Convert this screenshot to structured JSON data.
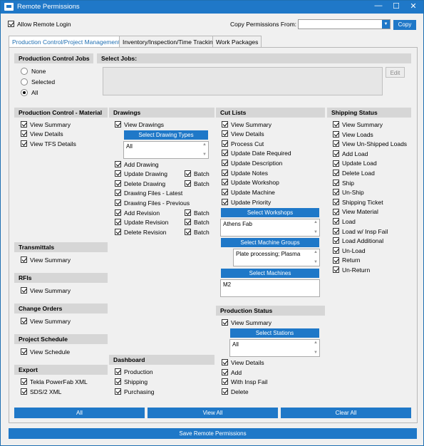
{
  "window": {
    "title": "Remote Permissions",
    "minimize": "—",
    "maximize": "☐",
    "close": "✕"
  },
  "top": {
    "allow_remote_login": "Allow Remote Login",
    "copy_from_label": "Copy Permissions From:",
    "copy_from_value": "",
    "copy_button": "Copy"
  },
  "tabs": [
    "Production Control/Project Management",
    "Inventory/Inspection/Time Tracking",
    "Work Packages"
  ],
  "pc_jobs": {
    "title": "Production Control Jobs",
    "options": [
      "None",
      "Selected",
      "All"
    ],
    "selected": "All"
  },
  "select_jobs": {
    "title": "Select Jobs:",
    "edit_button": "Edit"
  },
  "pcm": {
    "title": "Production Control - Material",
    "items": [
      "View Summary",
      "View Details",
      "View TFS Details"
    ]
  },
  "transmittals": {
    "title": "Transmittals",
    "items": [
      "View Summary"
    ]
  },
  "rfis": {
    "title": "RFIs",
    "items": [
      "View Summary"
    ]
  },
  "change_orders": {
    "title": "Change Orders",
    "items": [
      "View Summary"
    ]
  },
  "project_schedule": {
    "title": "Project Schedule",
    "items": [
      "View Schedule"
    ]
  },
  "export": {
    "title": "Export",
    "items": [
      "Tekla PowerFab XML",
      "SDS/2 XML"
    ]
  },
  "drawings": {
    "title": "Drawings",
    "view": "View Drawings",
    "select_types_button": "Select Drawing Types",
    "types_list": [
      "All"
    ],
    "items": [
      "Add Drawing",
      "Update Drawing",
      "Delete Drawing",
      "Drawing Files - Latest",
      "Drawing Files - Previous",
      "Add Revision",
      "Update Revision",
      "Delete Revision"
    ],
    "batch_label": "Batch"
  },
  "dashboard": {
    "title": "Dashboard",
    "items": [
      "Production",
      "Shipping",
      "Purchasing"
    ]
  },
  "cut_lists": {
    "title": "Cut Lists",
    "items": [
      "View Summary",
      "View Details",
      "Process Cut",
      "Update Date Required",
      "Update Description",
      "Update Notes",
      "Update Workshop",
      "Update Machine",
      "Update Priority"
    ],
    "workshops_button": "Select Workshops",
    "workshops_list": [
      "Athens Fab"
    ],
    "machine_groups_button": "Select Machine Groups",
    "machine_groups_list": [
      "Plate processing; Plasma"
    ],
    "machines_button": "Select Machines",
    "machines_list": [
      "M2"
    ]
  },
  "production_status": {
    "title": "Production Status",
    "view": "View Summary",
    "stations_button": "Select Stations",
    "stations_list": [
      "All"
    ],
    "items": [
      "View Details",
      "Add",
      "With Insp Fail",
      "Delete"
    ]
  },
  "shipping": {
    "title": "Shipping Status",
    "items": [
      "View Summary",
      "View Loads",
      "View Un-Shipped Loads",
      "Add Load",
      "Update Load",
      "Delete Load",
      "Ship",
      "Un-Ship",
      "Shipping Ticket",
      "View Material",
      "Load",
      "Load w/ Insp Fail",
      "Load Additional",
      "Un-Load",
      "Return",
      "Un-Return"
    ]
  },
  "bottom": {
    "all": "All",
    "view_all": "View All",
    "clear_all": "Clear All",
    "save": "Save Remote Permissions"
  },
  "colors": {
    "accent": "#1f78c8",
    "header_gray": "#d6d6d6"
  }
}
